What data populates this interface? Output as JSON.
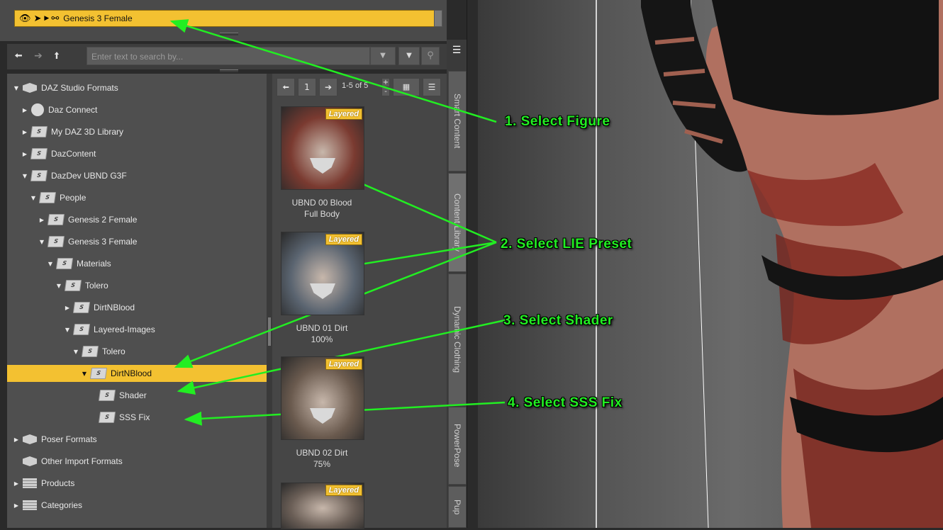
{
  "scene": {
    "icons": [
      "eye-icon",
      "pointer-icon",
      "expand-arrow-icon",
      "figure-icon"
    ],
    "selected_node": "Genesis 3 Female"
  },
  "search": {
    "placeholder": "Enter text to search by..."
  },
  "tree": {
    "items": [
      {
        "label": "DAZ Studio Formats",
        "depth": 0,
        "expanded": true,
        "icon": "daz-formats-icon"
      },
      {
        "label": "Daz Connect",
        "depth": 1,
        "expanded": false,
        "icon": "connect-disc-icon"
      },
      {
        "label": "My DAZ 3D Library",
        "depth": 1,
        "expanded": false,
        "icon": "folder-icon"
      },
      {
        "label": "DazContent",
        "depth": 1,
        "expanded": false,
        "icon": "folder-icon"
      },
      {
        "label": "DazDev UBND G3F",
        "depth": 1,
        "expanded": true,
        "icon": "folder-icon"
      },
      {
        "label": "People",
        "depth": 2,
        "expanded": true,
        "icon": "folder-icon"
      },
      {
        "label": "Genesis 2 Female",
        "depth": 3,
        "expanded": false,
        "icon": "folder-icon"
      },
      {
        "label": "Genesis 3 Female",
        "depth": 3,
        "expanded": true,
        "icon": "folder-icon"
      },
      {
        "label": "Materials",
        "depth": 4,
        "expanded": true,
        "icon": "folder-icon"
      },
      {
        "label": "Tolero",
        "depth": 5,
        "expanded": true,
        "icon": "folder-icon"
      },
      {
        "label": "DirtNBlood",
        "depth": 6,
        "expanded": false,
        "icon": "folder-icon"
      },
      {
        "label": "Layered-Images",
        "depth": 6,
        "expanded": true,
        "icon": "folder-icon"
      },
      {
        "label": "Tolero",
        "depth": 7,
        "expanded": true,
        "icon": "folder-icon"
      },
      {
        "label": "DirtNBlood",
        "depth": 8,
        "expanded": true,
        "icon": "folder-icon",
        "selected": true
      },
      {
        "label": "Shader",
        "depth": 9,
        "leaf": true,
        "icon": "folder-icon"
      },
      {
        "label": "SSS Fix",
        "depth": 9,
        "leaf": true,
        "icon": "folder-icon"
      },
      {
        "label": "Poser Formats",
        "depth": 0,
        "expanded": false,
        "icon": "poser-formats-icon"
      },
      {
        "label": "Other Import Formats",
        "depth": 0,
        "leaf": true,
        "icon": "import-formats-icon"
      },
      {
        "label": "Products",
        "depth": 0,
        "expanded": false,
        "icon": "products-icon"
      },
      {
        "label": "Categories",
        "depth": 0,
        "expanded": false,
        "icon": "categories-icon"
      }
    ]
  },
  "pager": {
    "page": "1",
    "range": "1-5 of 5"
  },
  "thumbnails": [
    {
      "badge": "Layered",
      "caption_line1": "UBND 00 Blood",
      "caption_line2": "Full Body",
      "tint": "#7a3a30"
    },
    {
      "badge": "Layered",
      "caption_line1": "UBND 01 Dirt",
      "caption_line2": "100%",
      "tint": "#5a6470"
    },
    {
      "badge": "Layered",
      "caption_line1": "UBND 02 Dirt",
      "caption_line2": "75%",
      "tint": "#6a5a4e"
    },
    {
      "badge": "Layered",
      "caption_line1": "",
      "caption_line2": "",
      "tint": "#6a5e56"
    }
  ],
  "side_tabs": [
    "Smart Content",
    "Content Library",
    "Dynamic Clothing",
    "PowerPose",
    "Pup"
  ],
  "annotations": [
    "1. Select Figure",
    "2. Select LIE Preset",
    "3. Select Shader",
    "4. Select SSS Fix"
  ],
  "colors": {
    "selection": "#f3c131",
    "annotation": "#22ee22"
  }
}
